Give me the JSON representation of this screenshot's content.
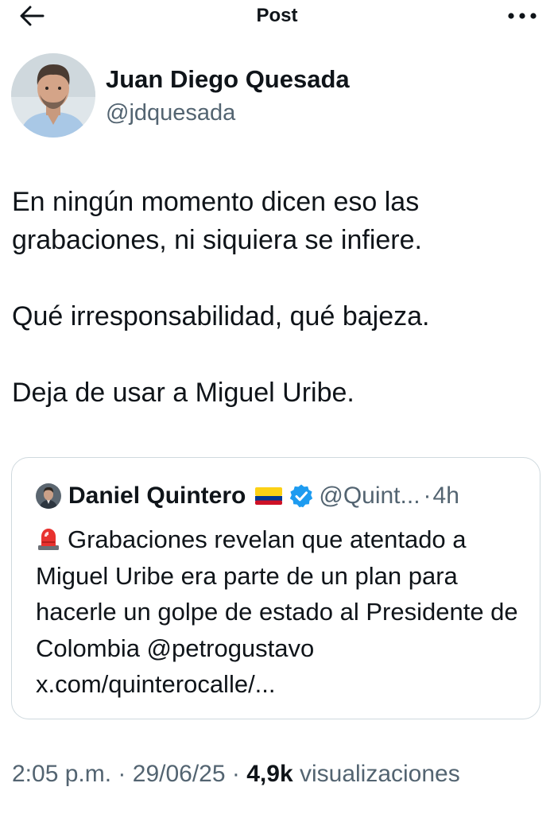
{
  "header": {
    "title": "Post"
  },
  "author": {
    "name": "Juan Diego Quesada",
    "handle": "@jdquesada"
  },
  "post": {
    "lines": [
      "En ningún momento dicen eso las grabaciones, ni siquiera se infiere.",
      "Qué irresponsabilidad, qué bajeza.",
      "Deja de usar a Miguel Uribe."
    ]
  },
  "quote": {
    "name": "Daniel Quintero",
    "handle": "@Quint...",
    "separator": "·",
    "time": "4h",
    "text": "Grabaciones revelan que atentado a Miguel Uribe era parte de un plan para hacerle un golpe de estado al Presidente de Colombia @petrogustavo x.com/quinterocalle/..."
  },
  "meta": {
    "time": "2:05 p.m.",
    "date": "29/06/25",
    "views_count": "4,9k",
    "views_label": "visualizaciones",
    "separator": "·"
  },
  "icons": {
    "back": "arrow-left-icon",
    "more": "more-horizontal-icon",
    "verified": "verified-badge-icon",
    "flag": "colombia-flag-icon",
    "siren": "siren-emoji-icon"
  },
  "colors": {
    "text": "#0f1419",
    "secondary": "#536471",
    "border": "#cfd9de",
    "verified": "#1d9bf0"
  }
}
